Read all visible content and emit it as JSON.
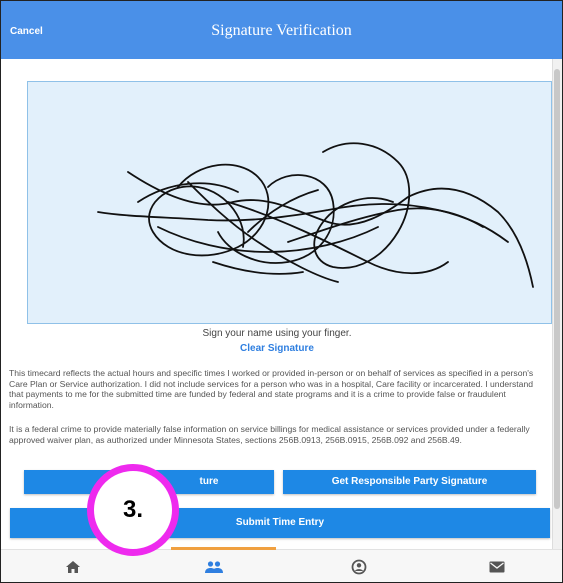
{
  "header": {
    "cancel_label": "Cancel",
    "title": "Signature Verification"
  },
  "signature": {
    "instruction": "Sign your name using your finger.",
    "clear_label": "Clear Signature"
  },
  "disclaimers": [
    "This timecard reflects the actual hours and specific times I worked or provided in-person or on behalf of services as specified in a person's Care Plan or Service authorization. I did not include services for a person who was in a hospital, Care facility or incarcerated. I understand that payments to me for the submitted time are funded by federal and state programs and it is a crime to provide false or fraudulent information.",
    "It is a federal crime to provide materially false information on service billings for medical assistance or services provided under a federally approved waiver plan, as authorized under Minnesota States, sections 256B.0913, 256B.0915, 256B.092 and 256B.49."
  ],
  "buttons": {
    "left_partial_label": "ture",
    "responsible_party_label": "Get Responsible Party Signature",
    "submit_label": "Submit Time Entry"
  },
  "callout": {
    "label": "3."
  },
  "nav": {
    "items": [
      {
        "icon": "home-icon"
      },
      {
        "icon": "people-icon",
        "active": true
      },
      {
        "icon": "account-icon"
      },
      {
        "icon": "mail-icon"
      }
    ]
  },
  "colors": {
    "header": "#4a90e8",
    "button": "#1e88e5",
    "link": "#2f7fe0",
    "pad": "#e2f0fb",
    "callout": "#ee2aee",
    "nav_indicator": "#f0a040"
  }
}
